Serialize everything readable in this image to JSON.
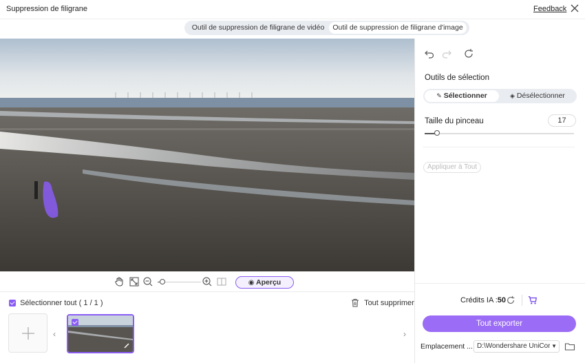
{
  "app": {
    "title": "Suppression de filigrane",
    "feedback": "Feedback"
  },
  "tabs": {
    "video": "Outil de suppression de filigrane de vidéo",
    "image": "Outil de suppression de filigrane d'image"
  },
  "editor": {
    "preview_label": "Aperçu"
  },
  "files": {
    "select_all": "Sélectionner tout ( 1 / 1 )",
    "delete_all": "Tout supprimer"
  },
  "panel": {
    "selection_tools": "Outils de sélection",
    "select": "Sélectionner",
    "deselect": "Désélectionner",
    "brush_size_label": "Taille du pinceau",
    "brush_size_value": "17",
    "apply_all": "Appliquer à Tout",
    "credits_label": "Crédits IA :",
    "credits_value": "50",
    "export_all": "Tout exporter",
    "location_label": "Emplacement ...",
    "location_value": "D:\\Wondershare UniCor"
  },
  "colors": {
    "accent": "#8a5cf5",
    "export": "#9b6cf5"
  }
}
